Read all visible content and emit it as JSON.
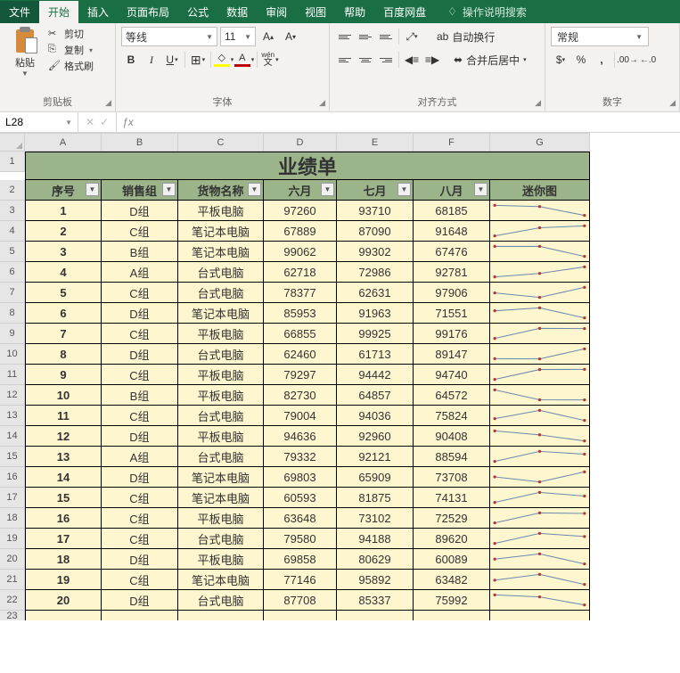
{
  "tabs": [
    "文件",
    "开始",
    "插入",
    "页面布局",
    "公式",
    "数据",
    "审阅",
    "视图",
    "帮助",
    "百度网盘"
  ],
  "active_tab": 1,
  "search_hint": "操作说明搜索",
  "ribbon": {
    "clipboard": {
      "paste": "粘贴",
      "cut": "剪切",
      "copy": "复制",
      "format_painter": "格式刷",
      "label": "剪贴板"
    },
    "font": {
      "name": "等线",
      "size": "11",
      "label": "字体",
      "B": "B",
      "I": "I",
      "U": "U",
      "A": "A",
      "wen": "wén"
    },
    "alignment": {
      "wrap": "自动换行",
      "merge": "合并后居中",
      "label": "对齐方式"
    },
    "number": {
      "format": "常规",
      "label": "数字"
    }
  },
  "name_box": "L28",
  "sheet": {
    "columns": [
      "A",
      "B",
      "C",
      "D",
      "E",
      "F",
      "G"
    ],
    "title": "业绩单",
    "headers": [
      "序号",
      "销售组",
      "货物名称",
      "六月",
      "七月",
      "八月",
      "迷你图"
    ],
    "rows": [
      {
        "n": 1,
        "g": "D组",
        "p": "平板电脑",
        "a": 97260,
        "b": 93710,
        "c": 68185
      },
      {
        "n": 2,
        "g": "C组",
        "p": "笔记本电脑",
        "a": 67889,
        "b": 87090,
        "c": 91648
      },
      {
        "n": 3,
        "g": "B组",
        "p": "笔记本电脑",
        "a": 99062,
        "b": 99302,
        "c": 67476
      },
      {
        "n": 4,
        "g": "A组",
        "p": "台式电脑",
        "a": 62718,
        "b": 72986,
        "c": 92781
      },
      {
        "n": 5,
        "g": "C组",
        "p": "台式电脑",
        "a": 78377,
        "b": 62631,
        "c": 97906
      },
      {
        "n": 6,
        "g": "D组",
        "p": "笔记本电脑",
        "a": 85953,
        "b": 91963,
        "c": 71551
      },
      {
        "n": 7,
        "g": "C组",
        "p": "平板电脑",
        "a": 66855,
        "b": 99925,
        "c": 99176
      },
      {
        "n": 8,
        "g": "D组",
        "p": "台式电脑",
        "a": 62460,
        "b": 61713,
        "c": 89147
      },
      {
        "n": 9,
        "g": "C组",
        "p": "平板电脑",
        "a": 79297,
        "b": 94442,
        "c": 94740
      },
      {
        "n": 10,
        "g": "B组",
        "p": "平板电脑",
        "a": 82730,
        "b": 64857,
        "c": 64572
      },
      {
        "n": 11,
        "g": "C组",
        "p": "台式电脑",
        "a": 79004,
        "b": 94036,
        "c": 75824
      },
      {
        "n": 12,
        "g": "D组",
        "p": "平板电脑",
        "a": 94636,
        "b": 92960,
        "c": 90408
      },
      {
        "n": 13,
        "g": "A组",
        "p": "台式电脑",
        "a": 79332,
        "b": 92121,
        "c": 88594
      },
      {
        "n": 14,
        "g": "D组",
        "p": "笔记本电脑",
        "a": 69803,
        "b": 65909,
        "c": 73708
      },
      {
        "n": 15,
        "g": "C组",
        "p": "笔记本电脑",
        "a": 60593,
        "b": 81875,
        "c": 74131
      },
      {
        "n": 16,
        "g": "C组",
        "p": "平板电脑",
        "a": 63648,
        "b": 73102,
        "c": 72529
      },
      {
        "n": 17,
        "g": "C组",
        "p": "台式电脑",
        "a": 79580,
        "b": 94188,
        "c": 89620
      },
      {
        "n": 18,
        "g": "D组",
        "p": "平板电脑",
        "a": 69858,
        "b": 80629,
        "c": 60089
      },
      {
        "n": 19,
        "g": "C组",
        "p": "笔记本电脑",
        "a": 77146,
        "b": 95892,
        "c": 63482
      },
      {
        "n": 20,
        "g": "D组",
        "p": "台式电脑",
        "a": 87708,
        "b": 85337,
        "c": 75992
      }
    ]
  },
  "chart_data": {
    "type": "line",
    "note": "per-row sparklines, x = [六月,七月,八月], y = corresponding row values",
    "categories": [
      "六月",
      "七月",
      "八月"
    ],
    "series": [
      {
        "name": "1",
        "values": [
          97260,
          93710,
          68185
        ]
      },
      {
        "name": "2",
        "values": [
          67889,
          87090,
          91648
        ]
      },
      {
        "name": "3",
        "values": [
          99062,
          99302,
          67476
        ]
      },
      {
        "name": "4",
        "values": [
          62718,
          72986,
          92781
        ]
      },
      {
        "name": "5",
        "values": [
          78377,
          62631,
          97906
        ]
      },
      {
        "name": "6",
        "values": [
          85953,
          91963,
          71551
        ]
      },
      {
        "name": "7",
        "values": [
          66855,
          99925,
          99176
        ]
      },
      {
        "name": "8",
        "values": [
          62460,
          61713,
          89147
        ]
      },
      {
        "name": "9",
        "values": [
          79297,
          94442,
          94740
        ]
      },
      {
        "name": "10",
        "values": [
          82730,
          64857,
          64572
        ]
      },
      {
        "name": "11",
        "values": [
          79004,
          94036,
          75824
        ]
      },
      {
        "name": "12",
        "values": [
          94636,
          92960,
          90408
        ]
      },
      {
        "name": "13",
        "values": [
          79332,
          92121,
          88594
        ]
      },
      {
        "name": "14",
        "values": [
          69803,
          65909,
          73708
        ]
      },
      {
        "name": "15",
        "values": [
          60593,
          81875,
          74131
        ]
      },
      {
        "name": "16",
        "values": [
          63648,
          73102,
          72529
        ]
      },
      {
        "name": "17",
        "values": [
          79580,
          94188,
          89620
        ]
      },
      {
        "name": "18",
        "values": [
          69858,
          80629,
          60089
        ]
      },
      {
        "name": "19",
        "values": [
          77146,
          95892,
          63482
        ]
      },
      {
        "name": "20",
        "values": [
          87708,
          85337,
          75992
        ]
      }
    ]
  }
}
